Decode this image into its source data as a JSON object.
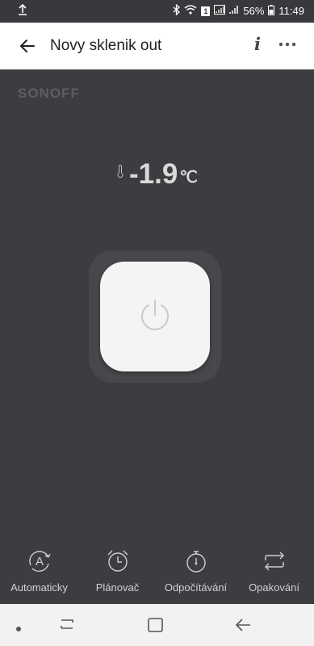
{
  "status": {
    "battery_percent": "56%",
    "time": "11:49",
    "sim_badge": "1"
  },
  "header": {
    "title": "Novy sklenik out",
    "info_label": "i"
  },
  "device": {
    "brand": "SONOFF",
    "temperature": "-1.9",
    "unit": "℃"
  },
  "features": [
    {
      "label": "Automaticky",
      "icon": "auto-mode-icon"
    },
    {
      "label": "Plánovač",
      "icon": "alarm-clock-icon"
    },
    {
      "label": "Odpočítávání",
      "icon": "stopwatch-icon"
    },
    {
      "label": "Opakování",
      "icon": "repeat-icon"
    }
  ],
  "colors": {
    "background": "#3c3d40",
    "header": "#ffffff",
    "power_button": "#f4f4f4"
  }
}
